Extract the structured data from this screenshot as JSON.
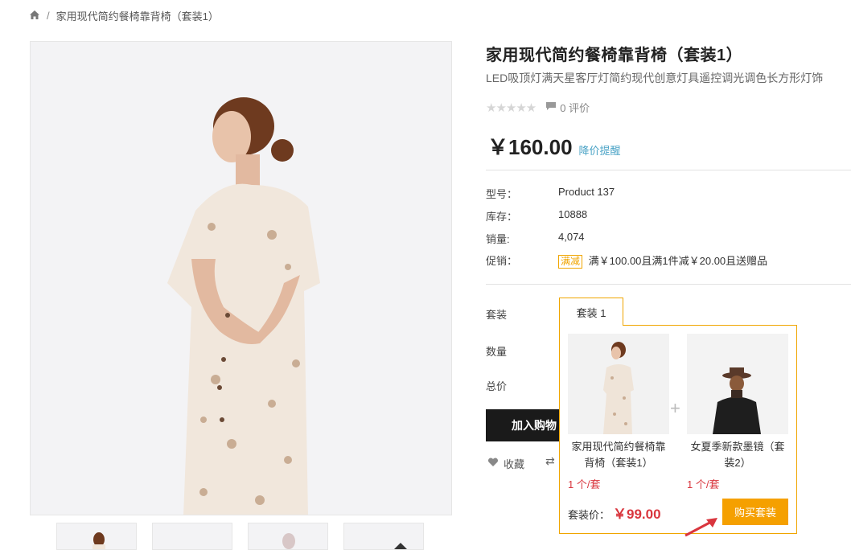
{
  "breadcrumb": {
    "current": "家用现代简约餐椅靠背椅（套装1）"
  },
  "product": {
    "title": "家用现代简约餐椅靠背椅（套装1）",
    "subtitle": "LED吸顶灯满天星客厅灯简约现代创意灯具遥控调光调色长方形灯饰",
    "stars": "★★★★★",
    "reviews": "0 评价",
    "price": "￥160.00",
    "price_alert": "降价提醒",
    "rating": 0
  },
  "specs": {
    "model_label": "型号：",
    "model_value": "Product 137",
    "stock_label": "库存：",
    "stock_value": "10888",
    "sales_label": "销量:",
    "sales_value": "4,074",
    "promo_label": "促销：",
    "promo_tag": "满减",
    "promo_value": "满￥100.00且满1件减￥20.00且送赠品"
  },
  "options": {
    "bundle_label": "套装",
    "qty_label": "数量",
    "total_label": "总价"
  },
  "actions": {
    "add_cart": "加入购物",
    "favorite": "收藏"
  },
  "bundle": {
    "tab": "套装 1",
    "items": [
      {
        "name": "家用现代简约餐椅靠背椅（套装1）",
        "qty": "1 个/套"
      },
      {
        "name": "女夏季新款墨镜（套装2）",
        "qty": "1 个/套"
      }
    ],
    "plus": "+",
    "total_label": "套装价：",
    "total_value": "￥99.00",
    "buy_label": "购买套装"
  },
  "colors": {
    "accent": "#f5a000",
    "price_red": "#d9363e",
    "link": "#4aa3c6"
  }
}
